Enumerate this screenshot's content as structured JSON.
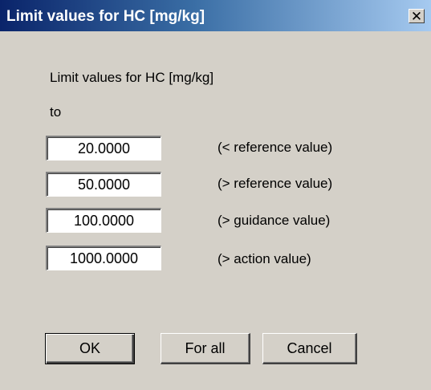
{
  "window": {
    "title": "Limit values for HC [mg/kg]",
    "close_glyph": "✕"
  },
  "header": {
    "heading": "Limit values for HC [mg/kg]",
    "to_label": "to"
  },
  "limits": [
    {
      "value": "20.0000",
      "description": "(< reference value)"
    },
    {
      "value": "50.0000",
      "description": "(> reference value)"
    },
    {
      "value": "100.0000",
      "description": "(> guidance value)"
    },
    {
      "value": "1000.0000",
      "description": "(> action value)"
    }
  ],
  "buttons": {
    "ok": "OK",
    "for_all": "For all",
    "cancel": "Cancel"
  }
}
